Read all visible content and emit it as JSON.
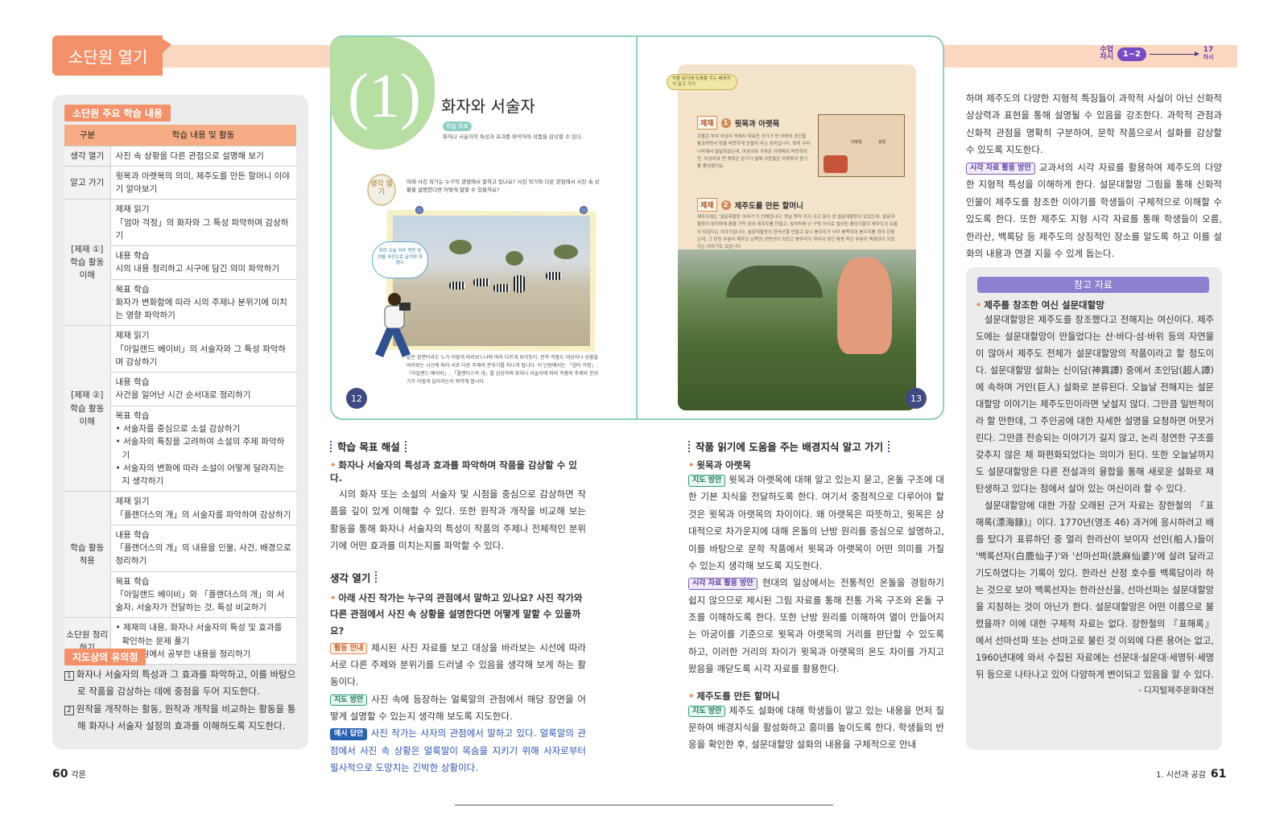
{
  "header": {
    "tag": "소단원 열기",
    "lesson_label_start": "수업 차시",
    "lesson_range": "1~2",
    "lesson_end": "17",
    "lesson_end_label": "차시"
  },
  "left": {
    "summary_title": "소단원 주요 학습 내용",
    "table_headers": [
      "구분",
      "학습 내용 및 활동"
    ],
    "rows": {
      "r1_cat": "생각 열기",
      "r1_text": "사진 속 상황을 다른 관점으로 설명해 보기",
      "r2_cat": "알고 가기",
      "r2_text": "윗목과 아랫목의 의미, 제주도를 만든 할머니 이야기 알아보기",
      "r3_cat": "[제재 ①] 학습 활동 이해",
      "r3a_head": "제재 읽기",
      "r3a_text": "「엄마 걱정」의 화자와 그 특성 파악하며 감상하기",
      "r3b_head": "내용 학습",
      "r3b_text": "시의 내용 정리하고 시구에 담긴 의미 파악하기",
      "r3c_head": "목표 학습",
      "r3c_text": "화자가 변화함에 따라 시의 주제나 분위기에 미치는 영향 파악하기",
      "r4_cat": "[제재 ②] 학습 활동 이해",
      "r4a_head": "제재 읽기",
      "r4a_text": "「아일랜드 베이비」의 서술자와 그 특성 파악하며 감상하기",
      "r4b_head": "내용 학습",
      "r4b_text": "사건을 일어난 시간 순서대로 정리하기",
      "r4c_head": "목표 학습",
      "r4c_b1": "서술자를 중심으로 소설 감상하기",
      "r4c_b2": "서술자의 특징을 고려하여 소설의 주제 파악하기",
      "r4c_b3": "서술자의 변화에 따라 소설이 어떻게 달라지는지 생각하기",
      "r5_cat": "학습 활동 적용",
      "r5a_head": "제재 읽기",
      "r5a_text": "「플랜더스의 개」의 서술자를 파악하며 감상하기",
      "r5b_head": "내용 학습",
      "r5b_text": "「플랜더스의 개」의 내용을 인물, 사건, 배경으로 정리하기",
      "r5c_head": "목표 학습",
      "r5c_text": "「아일랜드 베이비」와 「플랜더스의 개」의 서술자, 서술자가 전달하는 것, 특성 비교하기",
      "r6_cat": "소단원 정리하기",
      "r6_b1": "제재의 내용, 화자나 서술자의 특성 및 효과를 확인하는 문제 풀기",
      "r6_b2": "이 단원에서 공부한 내용을 정리하기"
    },
    "notes_title": "지도상의 유의점",
    "note1_num": "1",
    "note1": "화자나 서술자의 특성과 그 효과를 파악하고, 이를 바탕으로 작품을 감상하는 데에 중점을 두어 지도한다.",
    "note2_num": "2",
    "note2": "원작을 개작하는 활동, 원작과 개작을 비교하는 활동을 통해 화자나 서술자 설정의 효과를 이해하도록 지도한다."
  },
  "book": {
    "number": "(1)",
    "title": "화자와 서술자",
    "goal_chip": "학습 목표",
    "goal_text": "화자나 서술자의 특성과 효과를 파악하며 작품을 감상할 수 있다.",
    "think_badge": "생각 열기",
    "question": "아래 사진 작가는 누구의 관점에서 말하고 있나요? 사진 작가와 다른 관점에서 사진 속 상황을 설명한다면 어떻게 말할 수 있을까요?",
    "speech": "하하 오늘 아주 멋진 장면을 사진으로 남겨야 하겠다.",
    "caption": "같은 장면이라도 누가 어떻게 바라보느냐에 따라 다르게 보이듯이, 문학 작품도 대상이나 상황을 바라보는 시선에 따라 서로 다른 주제와 분위기를 지니게 됩니다. 이 단원에서는 「엄마 걱정」, 「아일랜드 베이비」, 「플랜더스의 개」를 감상하며 화자나 서술자에 따라 작품의 주제와 분위기가 어떻게 달라지는지 파악해 봅시다.",
    "page_left": "12",
    "banner": "작품 읽기에 도움을 주는 배경지식 알고 가기",
    "topic1_tag": "제재",
    "topic1_num": "1",
    "topic1_title": "윗목과 아랫목",
    "topic1_body": "온돌은 부엌 아궁이 속에서 데워진 공기가 방 아래의 공간을 통과하면서 방을 따뜻하게 만들어 주는 장치입니다. 특히 우리나라에서 발달하였는데, 아궁이와 가까운 아랫목이 따뜻하지만, 아궁이와 먼 윗목은 온기가 덜해 사람들은 아랫목의 잠기를 좋아했지요.",
    "label_upper": "아랫목",
    "label_lower": "윗목",
    "topic2_tag": "제재",
    "topic2_num": "2",
    "topic2_title": "제주도를 만든 할머니",
    "topic2_body": "제주도에는 '설문대할망 이야기'가 전해집니다. 옛날 옛적 키가 크고 힘이 센 설문대할망이 있었는데, 설문대할망이 앞치마에 흙을 가득 담아 제주도를 만들고, 앞치마에 난 구멍 사이로 떨어진 흙덩이들이 제주도의 오름이 되었다는 이야기입니다. 설문대할망이 한라산을 만들고 보니 봉우리가 너무 뾰족하여 봉우리를 꺾어 던졌는데, 그 던진 부분이 제주도 남쪽의 산방산이 되었고 봉우리가 꺾여서 생긴 움푹 파인 부분이 백록담이 되었다는 이야기도 있습니다.",
    "page_right": "13"
  },
  "col1": {
    "s1_title": "학습 목표 해설",
    "s1_sub": "화자나 서술자의 특성과 효과를 파악하며 작품을 감상할 수 있다.",
    "s1_body": "시의 화자 또는 소설의 서술자 및 시점을 중심으로 감상하면 작품을 깊이 있게 이해할 수 있다. 또한 원작과 개작을 비교해 보는 활동을 통해 화자나 서술자의 특성이 작품의 주제나 전체적인 분위기에 어떤 효과를 미치는지를 파악할 수 있다.",
    "s2_title": "생각 열기",
    "s2_sub": "아래 사진 작가는 누구의 관점에서 말하고 있나요? 사진 작가와 다른 관점에서 사진 속 상황을 설명한다면 어떻게 말할 수 있을까요?",
    "chip_guide": "활동 안내",
    "guide_text": "제시된 사진 자료를 보고 대상을 바라보는 시선에 따라 서로 다른 주제와 분위기를 드러낼 수 있음을 생각해 보게 하는 활동이다.",
    "chip_teach": "지도 방안",
    "teach_text": "사진 속에 등장하는 얼룩말의 관점에서 해당 장면을 어떻게 설명할 수 있는지 생각해 보도록 지도한다.",
    "chip_example": "예시 답안",
    "example_text": "사진 작가는 사자의 관점에서 말하고 있다. 얼룩말의 관점에서 사진 속 상황은 얼룩말이 목숨을 지키기 위해 사자로부터 필사적으로 도망치는 긴박한 상황이다."
  },
  "col2": {
    "title": "작품 읽기에 도움을 주는 배경지식 알고 가기",
    "sub1": "윗목과 아랫목",
    "chip_teach": "지도 방안",
    "t1": "윗목과 아랫목에 대해 알고 있는지 묻고, 온돌 구조에 대한 기본 지식을 전달하도록 한다. 여기서 중점적으로 다루어야 할 것은 윗목과 아랫목의 차이이다. 왜 아랫목은 따뜻하고, 윗목은 상대적으로 차가운지에 대해 온돌의 난방 원리를 중심으로 설명하고, 이를 바탕으로 문학 작품에서 윗목과 아랫목이 어떤 의미를 가질 수 있는지 생각해 보도록 지도한다.",
    "chip_visual": "시각 자료 활용 방안",
    "t2": "현대의 일상에서는 전통적인 온돌을 경험하기 쉽지 않으므로 제시된 그림 자료를 통해 전통 가옥 구조와 온돌 구조를 이해하도록 한다. 또한 난방 원리를 이해하여 열이 만들어지는 아궁이를 기준으로 윗목과 아랫목의 거리를 판단할 수 있도록 하고, 이러한 거리의 차이가 윗목과 아랫목의 온도 차이를 가지고 왔음을 깨닫도록 시각 자료를 활용한다.",
    "sub2": "제주도를 만든 할머니",
    "t3": "제주도 설화에 대해 학생들이 알고 있는 내용을 먼저 질문하여 배경지식을 활성화하고 흥미를 높이도록 한다. 학생들의 반응을 확인한 후, 설문대할망 설화의 내용을 구체적으로 안내"
  },
  "col3": {
    "top_text": "하며 제주도의 다양한 지형적 특징들이 과학적 사실이 아닌 신화적 상상력과 표현을 통해 설명될 수 있음을 강조한다. 과학적 관점과 신화적 관점을 명확히 구분하여, 문학 작품으로서 설화를 감상할 수 있도록 지도한다.",
    "chip_visual": "시각 자료 활용 방안",
    "visual_text": "교과서의 시각 자료를 활용하여 제주도의 다양한 지형적 특성을 이해하게 한다. 설문대할망 그림을 통해 신화적 인물이 제주도를 창조한 이야기를 학생들이 구체적으로 이해할 수 있도록 한다. 또한 제주도 지형 시각 자료를 통해 학생들이 오름, 한라산, 백록담 등 제주도의 상징적인 장소를 알도록 하고 이를 설화의 내용과 연결 지을 수 있게 돕는다.",
    "ref_title": "참고 자료",
    "ref_sub": "제주를 창조한 여신 설문대할망",
    "ref_p1": "설문대할망은 제주도를 창조했다고 전해지는 여신이다. 제주도에는 설문대할망이 만들었다는 산·바다·섬·바위 등의 자연물이 많아서 제주도 전체가 설문대할망의 작품이라고 할 정도이다. 설문대할망 설화는 신이담(神異譚) 중에서 초인담(超人譚)에 속하며 거인(巨人) 설화로 분류된다. 오늘날 전해지는 설문대할망 이야기는 제주도민이라면 낯설지 않다. 그만큼 일반적이라 할 만한데, 그 주인공에 대한 자세한 설명을 요청하면 머뭇거린다. 그만큼 전승되는 이야기가 길지 않고, 논리 정연한 구조를 갖추지 않은 채 파편화되었다는 의미가 된다. 또한 오늘날까지도 설문대할망은 다른 전설과의 융합을 통해 새로운 설화로 재탄생하고 있다는 점에서 살아 있는 여신이라 할 수 있다.",
    "ref_p2": "설문대할망에 대한 가장 오래된 근거 자료는 장한철의 『표해록(漂海錄)』이다. 1770년(영조 46) 과거에 응시하려고 배를 탔다가 표류하던 중 멀리 한라산이 보이자 선인(船人)들이 '백록선자(白鹿仙子)'와 '선마선파(詵麻仙婆)'에 살려 달라고 기도하였다는 기록이 있다. 한라산 산정 호수를 백록담이라 하는 것으로 보아 백록선자는 한라산신을, 선마선파는 설문대할망을 지칭하는 것이 아닌가 한다. 설문대할망은 어떤 이름으로 불렸을까? 이에 대한 구체적 자료는 없다. 장한철의 『표해록』에서 선마선파 또는 선마고로 불린 것 이외에 다른 용어는 없고, 1960년대에 와서 수집된 자료에는 선문대·설문대·세명뒤·세명뒤 등으로 나타나고 있어 다양하게 변이되고 있음을 알 수 있다.",
    "ref_source": "- 디지털제주문화대전"
  },
  "footer": {
    "left_page": "60",
    "left_label": "각론",
    "right_label": "1. 시선과 공감",
    "right_page": "61"
  },
  "colors": {
    "orange": "#f3916a",
    "teal": "#8fcfc4",
    "purple": "#8e7fd1",
    "navy": "#3f4a83"
  }
}
